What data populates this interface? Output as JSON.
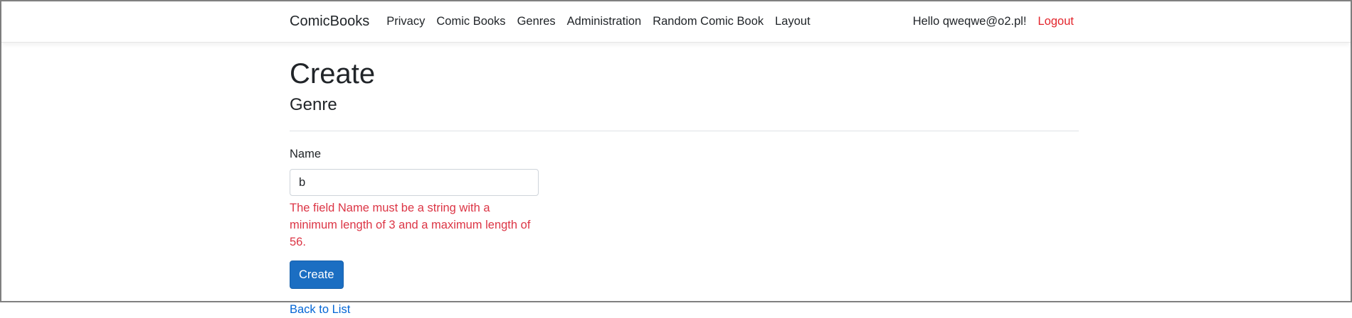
{
  "navbar": {
    "brand": "ComicBooks",
    "links": [
      "Privacy",
      "Comic Books",
      "Genres",
      "Administration",
      "Random Comic Book",
      "Layout"
    ],
    "greeting": "Hello qweqwe@o2.pl!",
    "logout": "Logout"
  },
  "page": {
    "title": "Create",
    "subtitle": "Genre"
  },
  "form": {
    "name_label": "Name",
    "name_value": "b",
    "name_error": "The field Name must be a string with a minimum length of 3 and a maximum length of 56.",
    "submit_label": "Create",
    "back_link": "Back to List"
  },
  "colors": {
    "primary_button": "#1b6ec2",
    "error_text": "#dc3545",
    "logout_text": "#e3242b",
    "link": "#0366d6"
  }
}
